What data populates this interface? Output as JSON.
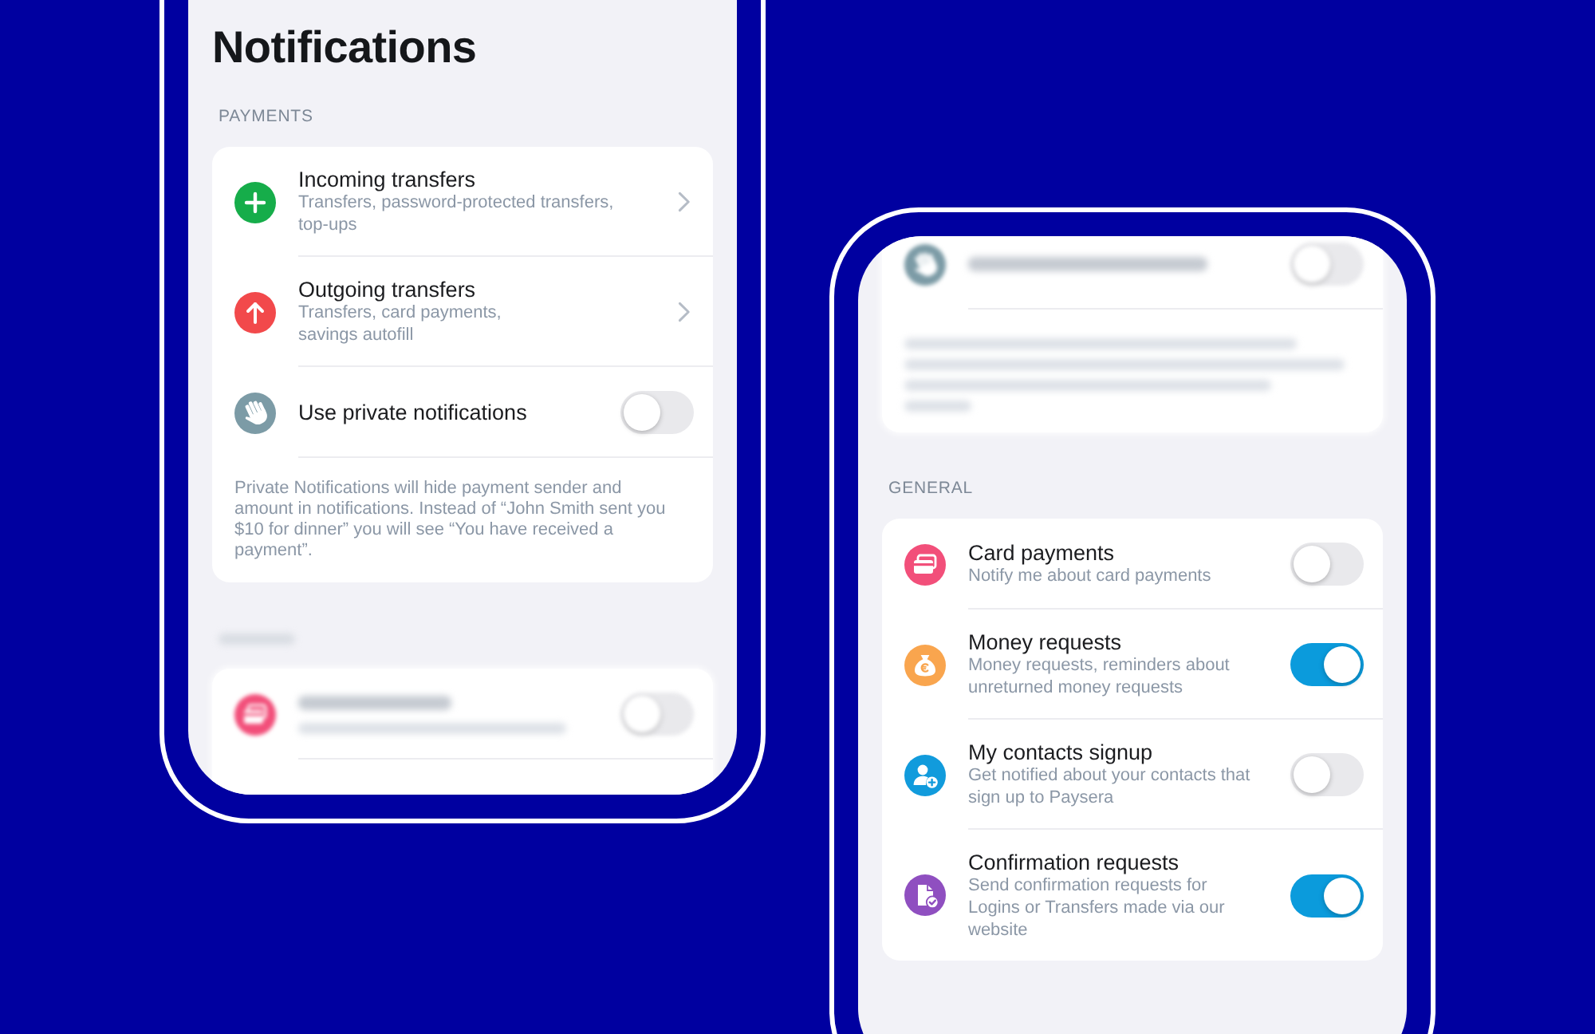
{
  "phones": [
    {
      "title": "Notifications",
      "sections": [
        {
          "header": "PAYMENTS",
          "blurred": false,
          "rows": [
            {
              "kind": "link",
              "title": "Incoming transfers",
              "subtitle": "Transfers, password-protected transfers, top-ups",
              "color": "#16ad4a"
            },
            {
              "kind": "link",
              "title": "Outgoing transfers",
              "subtitle": "Transfers, card payments,\nsavings autofill",
              "color": "#f2494b"
            },
            {
              "kind": "toggle",
              "title": "Use private notifications",
              "on": false,
              "color": "#7c9ba6"
            }
          ],
          "note": "Private Notifications will hide payment sender and amount in notifications. Instead of “John Smith sent you $10 for dinner” you will see “You have received a payment”."
        },
        {
          "blurred": true,
          "header_bar": true,
          "rows": [
            {
              "kind": "toggle",
              "subtitle_bar": true,
              "on": false,
              "color": "#f24f7a"
            }
          ]
        }
      ]
    },
    {
      "sections": [
        {
          "blurred": true,
          "rows": [
            {
              "kind": "toggle",
              "on": false,
              "color": "#7c9ba6"
            }
          ],
          "note_bar": true
        },
        {
          "header": "GENERAL",
          "blurred": false,
          "rows": [
            {
              "kind": "toggle",
              "title": "Card payments",
              "subtitle": "Notify me about card payments",
              "on": false,
              "color": "#f24f7a"
            },
            {
              "kind": "toggle",
              "title": "Money requests",
              "subtitle": "Money requests, reminders about unreturned money requests",
              "on": true,
              "color": "#f9a54e"
            },
            {
              "kind": "toggle",
              "title": "My contacts signup",
              "subtitle": "Get notified about your contacts that sign up to Paysera",
              "on": false,
              "color": "#119bdc"
            },
            {
              "kind": "toggle",
              "title": "Confirmation requests",
              "subtitle": "Send confirmation requests for Logins or Transfers made via our website",
              "on": true,
              "color": "#8f4fc0"
            }
          ]
        }
      ]
    }
  ]
}
